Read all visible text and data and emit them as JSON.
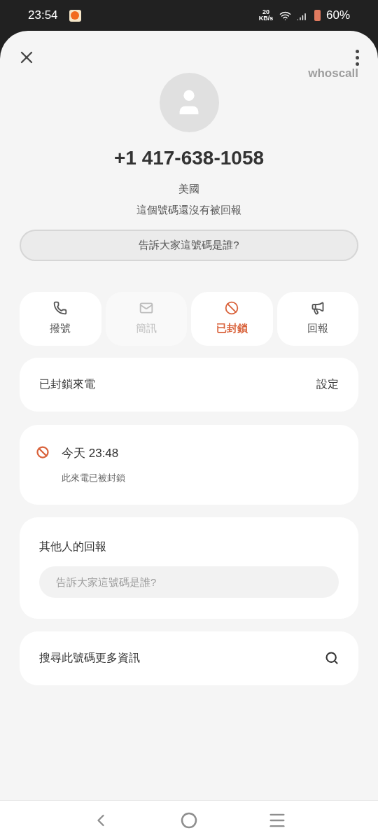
{
  "status_bar": {
    "time": "23:54",
    "network_speed": "20 KB/s",
    "battery": "60%"
  },
  "brand": "whoscall",
  "caller": {
    "number": "+1 417-638-1058",
    "country": "美國",
    "report_status": "這個號碼還沒有被回報",
    "tell_button": "告訴大家這號碼是誰?"
  },
  "actions": [
    {
      "kind": "call",
      "label": "撥號",
      "disabled": false,
      "active": false
    },
    {
      "kind": "message",
      "label": "簡訊",
      "disabled": true,
      "active": false
    },
    {
      "kind": "block",
      "label": "已封鎖",
      "disabled": false,
      "active": true
    },
    {
      "kind": "report",
      "label": "回報",
      "disabled": false,
      "active": false
    }
  ],
  "blocked_calls": {
    "title": "已封鎖來電",
    "action": "設定"
  },
  "call_log": [
    {
      "time": "今天 23:48",
      "note": "此來電已被封鎖"
    }
  ],
  "others_reports": {
    "title": "其他人的回報",
    "placeholder": "告訴大家這號碼是誰?"
  },
  "search_more": {
    "label": "搜尋此號碼更多資訊"
  }
}
